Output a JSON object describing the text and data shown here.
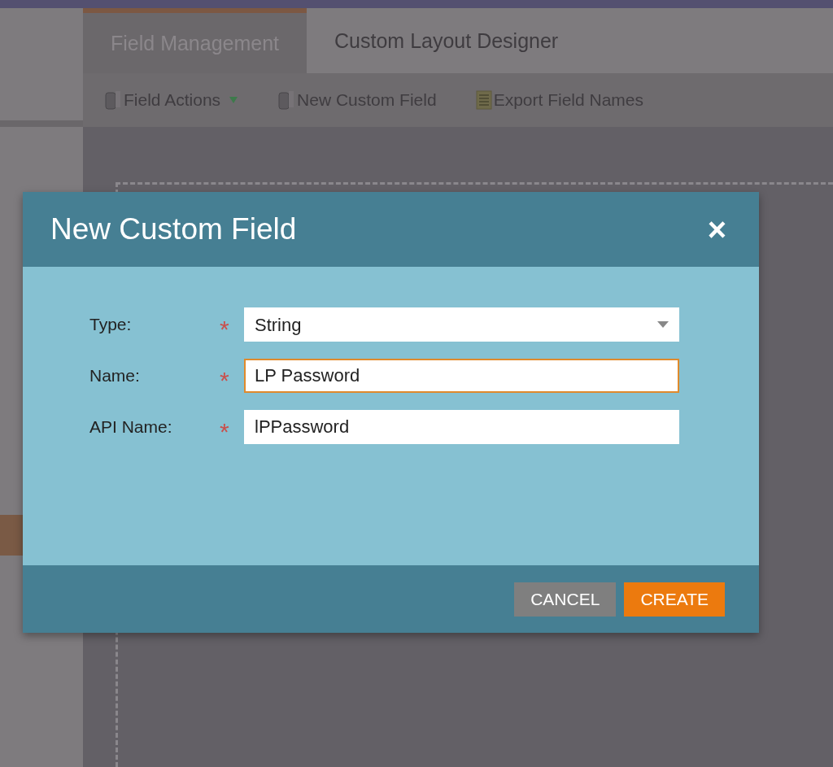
{
  "tabs": [
    {
      "label": "Field Management",
      "selected": true
    },
    {
      "label": "Custom Layout Designer",
      "selected": false
    }
  ],
  "toolbar": [
    {
      "label": "Field Actions",
      "kind": "dropdown"
    },
    {
      "label": "New Custom Field",
      "kind": "button"
    },
    {
      "label": "Export Field Names",
      "kind": "button"
    }
  ],
  "dialog": {
    "title": "New Custom Field",
    "close": "×",
    "fields": [
      {
        "label": "Type:",
        "required_mark": "*",
        "kind": "select",
        "value": "String",
        "focused": false
      },
      {
        "label": "Name:",
        "required_mark": "*",
        "kind": "text",
        "value": "LP Password",
        "focused": true
      },
      {
        "label": "API Name:",
        "required_mark": "*",
        "kind": "text",
        "value": "lPPassword",
        "focused": false
      }
    ],
    "buttons": [
      {
        "label": "CANCEL",
        "kind": "secondary"
      },
      {
        "label": "CREATE",
        "kind": "primary"
      }
    ]
  }
}
